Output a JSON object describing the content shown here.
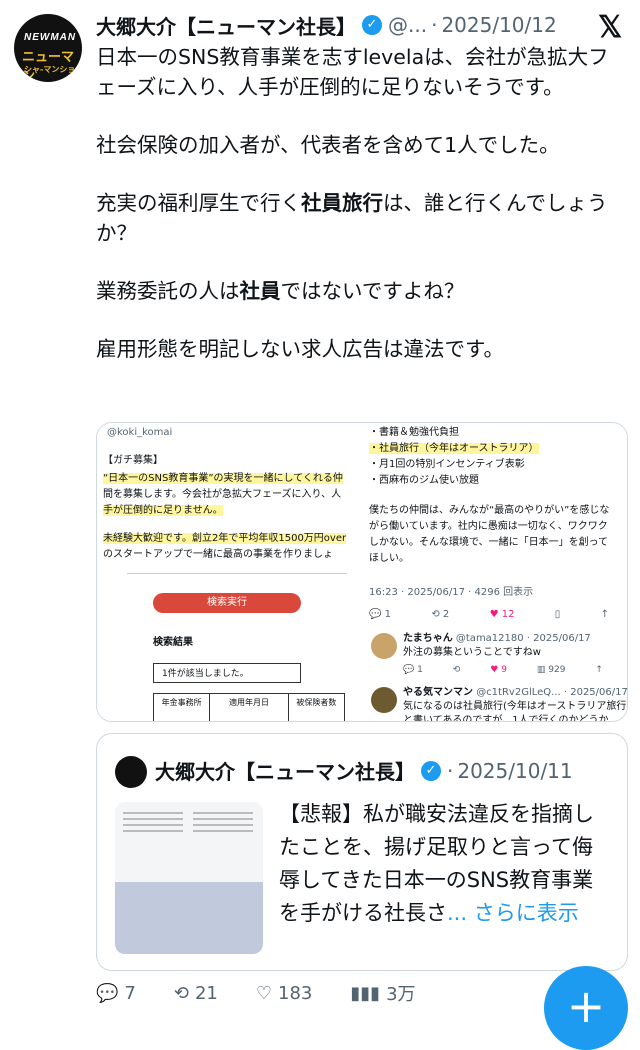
{
  "author": {
    "name": "大郷大介【ニューマン社長】",
    "handle": "@...",
    "sep": "·",
    "date": "2025/10/12",
    "avatar_text": [
      "NEWMAN",
      "ニューマン",
      "シャ-マンション"
    ]
  },
  "tweet": {
    "paragraphs": [
      "日本一のSNS教育事業を志すlevelaは、会社が急拡大フェーズに入り、人手が圧倒的に足りないそうです。",
      "社会保険の加入者が、代表者を含めて1人でした。",
      [
        "充実の福利厚生で行く",
        "社員旅行",
        "は、誰と行くんでしょうか？"
      ],
      [
        "業務委託の人は",
        "社員",
        "ではないですよね？"
      ],
      "雇用形態を明記しない求人広告は違法です。"
    ]
  },
  "media": {
    "left": {
      "handle": "@koki_komai",
      "lines": [
        "【ガチ募集】",
        "“日本一のSNS教育事業”の実現を一緒にしてくれる仲",
        "間を募集します。今会社が急拡大フェーズに入り、人",
        "手が圧倒的に足りません。",
        "未経験大歓迎です。創立2年で平均年収1500万円over",
        "のスタートアップで一緒に最高の事業を作りましょ"
      ],
      "search_btn": "検索実行",
      "result_title": "検索結果",
      "result_count": "1件が該当しました。",
      "col1": "年金事務所",
      "col2": "適用年月日",
      "col3": "被保険者数"
    },
    "right": {
      "items": [
        "・書籍＆勉強代負担",
        "・社員旅行（今年はオーストラリア）",
        "・月1回の特別インセンティブ表彰",
        "・西麻布のジム使い放題"
      ],
      "para": [
        "僕たちの仲間は、みんなが“最高のやりがい”を感じな",
        "がら働いています。社内に愚痴は一切なく、ワクワク",
        "しかない。そんな環境で、一緒に「日本一」を創って",
        "ほしい。"
      ],
      "meta": "16:23 · 2025/06/17 · 4296 回表示",
      "stats": [
        "1",
        "2",
        "12"
      ],
      "reply1": {
        "name": "たまちゃん",
        "handle": "@tama12180 · 2025/06/17",
        "text": "外注の募集ということですねw",
        "stats": [
          "1",
          "9",
          "929"
        ]
      },
      "reply2": {
        "name": "やる気マンマン",
        "handle": "@c1tRv2GlLeQ... · 2025/06/17",
        "text": [
          "気になるのは社員旅行(今年はオーストラリア旅行)",
          "と書いてあるのですが、1人で行くのかどうか..."
        ]
      }
    }
  },
  "quote": {
    "name": "大郷大介【ニューマン社長】",
    "date": "2025/10/11",
    "text": "【悲報】私が職安法違反を指摘したことを、揚げ足取りと言って侮辱してきた日本一のSNS教育事業を手がける社長さ",
    "more": "... さらに表示"
  },
  "actions": {
    "replies": "7",
    "retweets": "21",
    "likes": "183",
    "views": "3万"
  },
  "colors": {
    "accent": "#1d9bf0",
    "highlight": "#fff59d",
    "red": "#d0001c"
  }
}
